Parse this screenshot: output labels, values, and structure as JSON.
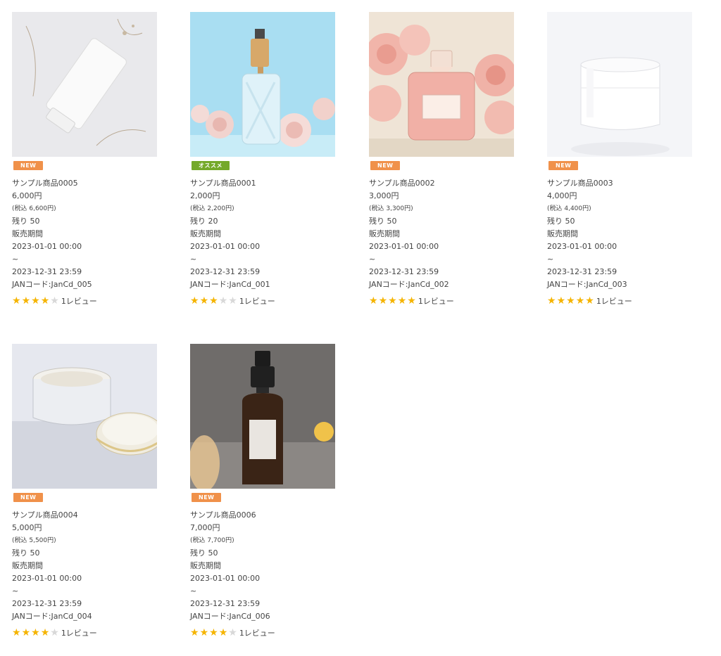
{
  "products": [
    {
      "name": "サンプル商品0005",
      "price": "6,000円",
      "tax": "(税込 6,600円)",
      "stock": "残り 50",
      "period_label": "販売期間",
      "start": "2023-01-01 00:00",
      "sep": "~",
      "end": "2023-12-31 23:59",
      "jan": "JANコード:JanCd_005",
      "rating": 4,
      "review": "1レビュー",
      "badge": "NEW",
      "badge_type": "new",
      "image": "tube-icon"
    },
    {
      "name": "サンプル商品0001",
      "price": "2,000円",
      "tax": "(税込 2,200円)",
      "stock": "残り 20",
      "period_label": "販売期間",
      "start": "2023-01-01 00:00",
      "sep": "~",
      "end": "2023-12-31 23:59",
      "jan": "JANコード:JanCd_001",
      "rating": 3,
      "review": "1レビュー",
      "badge": "オススメ",
      "badge_type": "recommend",
      "image": "spray-bottle-icon"
    },
    {
      "name": "サンプル商品0002",
      "price": "3,000円",
      "tax": "(税込 3,300円)",
      "stock": "残り 50",
      "period_label": "販売期間",
      "start": "2023-01-01 00:00",
      "sep": "~",
      "end": "2023-12-31 23:59",
      "jan": "JANコード:JanCd_002",
      "rating": 5,
      "review": "1レビュー",
      "badge": "NEW",
      "badge_type": "new",
      "image": "perfume-bottle-icon"
    },
    {
      "name": "サンプル商品0003",
      "price": "4,000円",
      "tax": "(税込 4,400円)",
      "stock": "残り 50",
      "period_label": "販売期間",
      "start": "2023-01-01 00:00",
      "sep": "~",
      "end": "2023-12-31 23:59",
      "jan": "JANコード:JanCd_003",
      "rating": 5,
      "review": "1レビュー",
      "badge": "NEW",
      "badge_type": "new",
      "image": "cream-jar-icon"
    },
    {
      "name": "サンプル商品0004",
      "price": "5,000円",
      "tax": "(税込 5,500円)",
      "stock": "残り 50",
      "period_label": "販売期間",
      "start": "2023-01-01 00:00",
      "sep": "~",
      "end": "2023-12-31 23:59",
      "jan": "JANコード:JanCd_004",
      "rating": 4,
      "review": "1レビュー",
      "badge": "NEW",
      "badge_type": "new",
      "image": "open-cream-jar-icon"
    },
    {
      "name": "サンプル商品0006",
      "price": "7,000円",
      "tax": "(税込 7,700円)",
      "stock": "残り 50",
      "period_label": "販売期間",
      "start": "2023-01-01 00:00",
      "sep": "~",
      "end": "2023-12-31 23:59",
      "jan": "JANコード:JanCd_006",
      "rating": 4,
      "review": "1レビュー",
      "badge": "NEW",
      "badge_type": "new",
      "image": "amber-spray-bottle-icon"
    }
  ],
  "colors": {
    "badge_new": "#f0914a",
    "badge_recommend": "#74a92a",
    "star_on": "#f5b400",
    "star_off": "#d8d8d8"
  }
}
